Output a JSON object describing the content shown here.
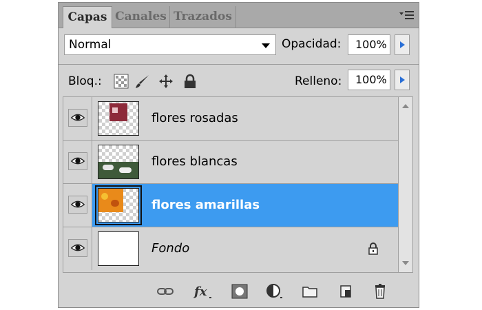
{
  "tabs": [
    {
      "label": "Capas",
      "active": true
    },
    {
      "label": "Canales",
      "active": false
    },
    {
      "label": "Trazados",
      "active": false
    }
  ],
  "blend": {
    "mode": "Normal"
  },
  "opacity": {
    "label": "Opacidad:",
    "value": "100%"
  },
  "lock": {
    "label": "Bloq.:",
    "icons": [
      "lock-transparent-pixels-icon",
      "lock-image-pixels-icon",
      "lock-position-icon",
      "lock-all-icon"
    ]
  },
  "fill": {
    "label": "Relleno:",
    "value": "100%"
  },
  "layers": [
    {
      "name": "flores rosadas",
      "visible": true,
      "selected": false
    },
    {
      "name": "flores blancas",
      "visible": true,
      "selected": false
    },
    {
      "name": "flores amarillas",
      "visible": true,
      "selected": true
    },
    {
      "name": "Fondo",
      "visible": true,
      "selected": false,
      "locked": true
    }
  ],
  "footer_icons": [
    "link-layers-icon",
    "fx-icon",
    "layer-mask-icon",
    "adjustment-layer-icon",
    "new-group-icon",
    "new-layer-icon",
    "trash-icon"
  ],
  "colors": {
    "selection": "#3d9bf0",
    "panel": "#d4d4d4",
    "tabbar": "#a9a9a9"
  }
}
